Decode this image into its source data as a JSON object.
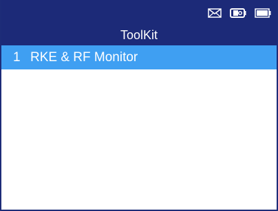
{
  "status_bar": {
    "icons": [
      "mail-icon",
      "vehicle-connection-icon",
      "battery-icon"
    ]
  },
  "header": {
    "title": "ToolKit"
  },
  "menu": {
    "items": [
      {
        "number": "1",
        "label": "RKE & RF Monitor",
        "selected": true
      }
    ]
  },
  "colors": {
    "header_bg": "#1c2a78",
    "selected_bg": "#3f9ff2",
    "text_light": "#ffffff"
  }
}
